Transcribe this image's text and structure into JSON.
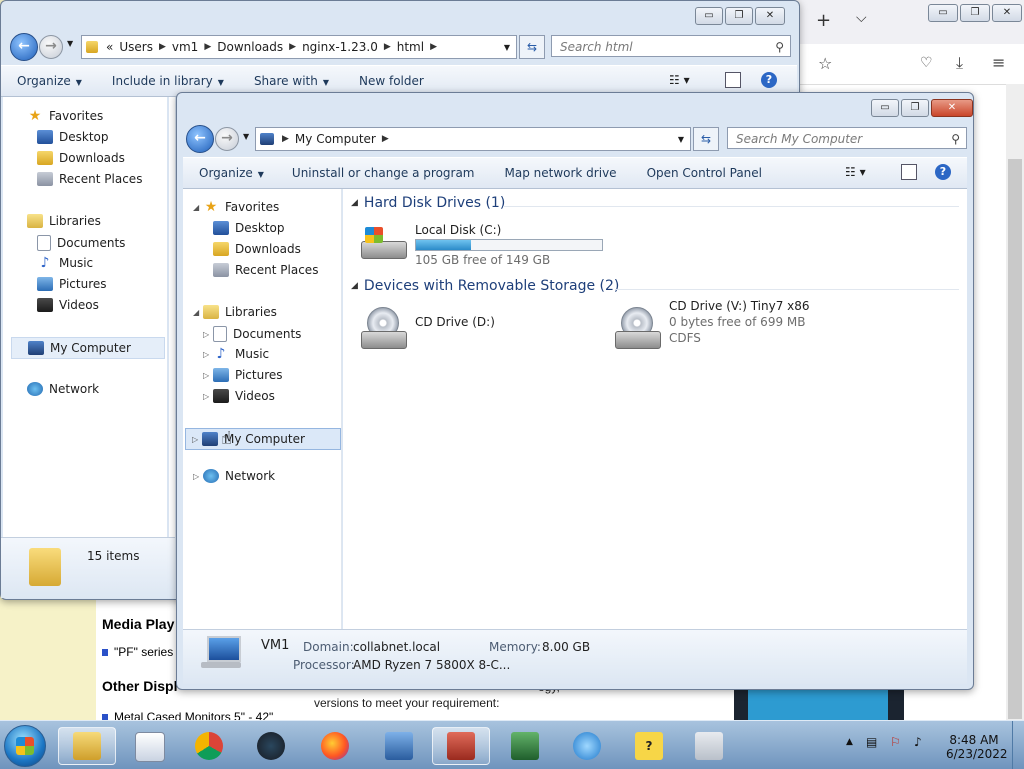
{
  "browser": {
    "new_tab": "+",
    "tab_list": "⌵",
    "window_buttons": [
      "▭",
      "❐",
      "✕"
    ],
    "toolbar_icons": [
      "pocket-icon",
      "download-icon",
      "menu-icon"
    ]
  },
  "webpage": {
    "heading1": "Media Play",
    "bullet1": "\"PF\" series",
    "heading2": "Other Displ",
    "bullet2": "Metal Cased Monitors 5\" - 42\"",
    "body_line1": "ogy,",
    "body_line2": "versions to meet your requirement:"
  },
  "back_window": {
    "address_crumbs": [
      "«",
      "Users",
      "vm1",
      "Downloads",
      "nginx-1.23.0",
      "html"
    ],
    "search_placeholder": "Search html",
    "toolbar": [
      "Organize",
      "Include in library",
      "Share with",
      "New folder"
    ],
    "nav": {
      "favorites": "Favorites",
      "desktop": "Desktop",
      "downloads": "Downloads",
      "recent": "Recent Places",
      "libraries": "Libraries",
      "documents": "Documents",
      "music": "Music",
      "pictures": "Pictures",
      "videos": "Videos",
      "computer": "My Computer",
      "network": "Network"
    },
    "status": "15 items"
  },
  "front_window": {
    "address_crumbs": [
      "My Computer"
    ],
    "search_placeholder": "Search My Computer",
    "toolbar": [
      "Organize",
      "Uninstall or change a program",
      "Map network drive",
      "Open Control Panel"
    ],
    "nav": {
      "favorites": "Favorites",
      "desktop": "Desktop",
      "downloads": "Downloads",
      "recent": "Recent Places",
      "libraries": "Libraries",
      "documents": "Documents",
      "music": "Music",
      "pictures": "Pictures",
      "videos": "Videos",
      "computer": "My Computer",
      "network": "Network"
    },
    "groups": {
      "hdd": "Hard Disk Drives (1)",
      "removable": "Devices with Removable Storage (2)"
    },
    "drives": {
      "c_name": "Local Disk (C:)",
      "c_free": "105 GB free of 149 GB",
      "c_used_fraction": 0.295,
      "d_name": "CD Drive (D:)",
      "v_name": "CD Drive (V:) Tiny7 x86",
      "v_free": "0 bytes free of 699 MB",
      "v_fs": "CDFS"
    },
    "details": {
      "computer_name": "VM1",
      "domain_label": "Domain:",
      "domain": "collabnet.local",
      "memory_label": "Memory:",
      "memory": "8.00 GB",
      "processor_label": "Processor:",
      "processor": "AMD Ryzen 7 5800X 8-C..."
    }
  },
  "taskbar": {
    "apps": [
      "explorer-icon",
      "media-player-icon",
      "chrome-icon",
      "steam-icon",
      "firefox-icon",
      "network-tool-icon",
      "installer-icon",
      "system-monitor-icon",
      "internet-explorer-icon",
      "help-icon",
      "blank-app-icon"
    ],
    "time": "8:48 AM",
    "date": "6/23/2022"
  },
  "colors": {
    "window_frame": "#dbe6f3",
    "group_heading": "#1e3f7a",
    "progress_fill": "#2b8bc9",
    "taskbar": "#8cadd0"
  }
}
